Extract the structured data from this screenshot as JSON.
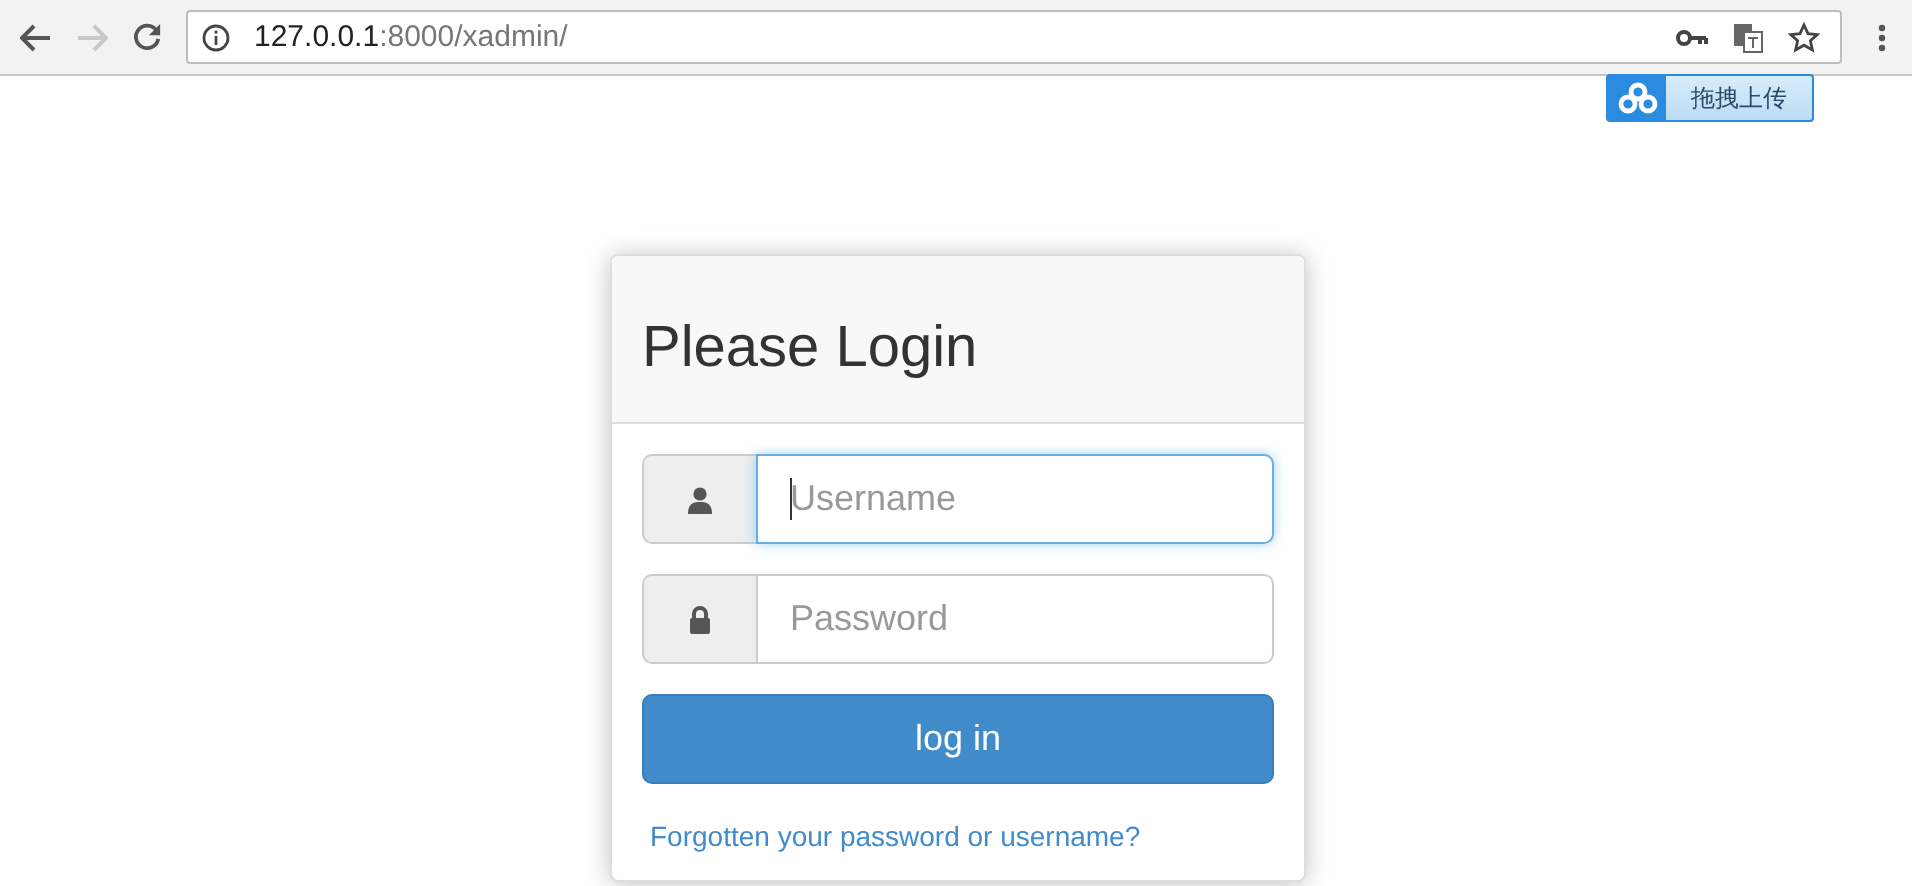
{
  "browser": {
    "url_host": "127.0.0.1",
    "url_path": ":8000/xadmin/"
  },
  "upload_widget": {
    "label": "拖拽上传"
  },
  "login": {
    "title": "Please Login",
    "fields": [
      {
        "kind": "user",
        "placeholder": "Username",
        "focused": true
      },
      {
        "kind": "lock",
        "placeholder": "Password",
        "focused": false
      }
    ],
    "button": "log in",
    "link": "Forgotten your password or username?"
  }
}
